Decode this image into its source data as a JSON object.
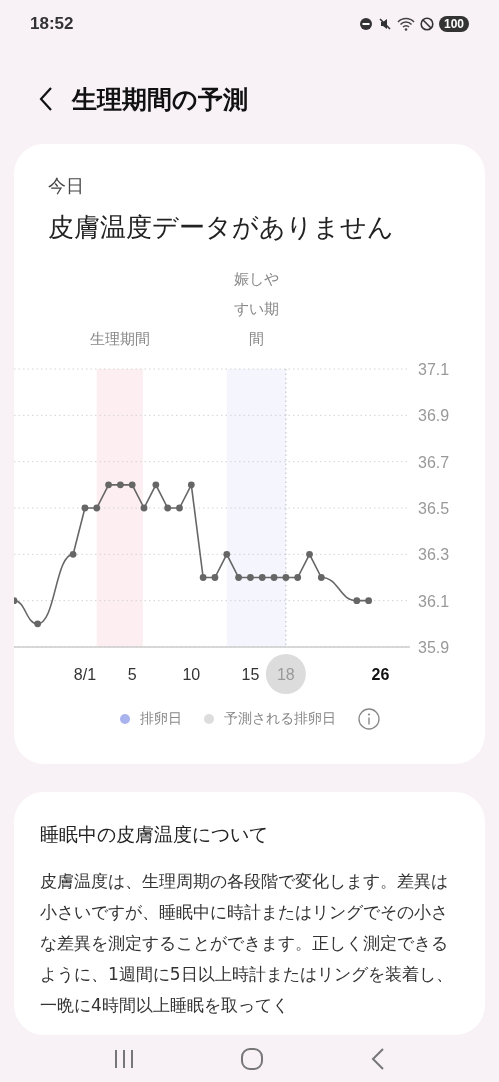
{
  "status_bar": {
    "time": "18:52",
    "battery": "100"
  },
  "header": {
    "title": "生理期間の予測"
  },
  "summary_card": {
    "label": "今日",
    "message": "皮膚温度データがありません",
    "chart_data": {
      "type": "line",
      "x": [
        -5,
        -3,
        0,
        1,
        2,
        3,
        4,
        5,
        6,
        7,
        8,
        9,
        10,
        11,
        12,
        13,
        14,
        15,
        16,
        17,
        18,
        19,
        20,
        21,
        24,
        25
      ],
      "grid": true,
      "series": [
        {
          "color": "#666666",
          "marker": "o",
          "values": [
            36.1,
            36.0,
            36.3,
            36.5,
            36.5,
            36.6,
            36.6,
            36.6,
            36.5,
            36.6,
            36.5,
            36.5,
            36.6,
            36.2,
            36.2,
            36.3,
            36.2,
            36.2,
            36.2,
            36.2,
            36.2,
            36.2,
            36.3,
            36.2,
            36.1,
            36.1
          ]
        }
      ],
      "xlim": [
        -5,
        28.5
      ],
      "ylim": [
        35.9,
        37.1
      ],
      "xticks": [
        {
          "value": 1,
          "label": "8/1"
        },
        {
          "value": 5,
          "label": "5"
        },
        {
          "value": 10,
          "label": "10"
        },
        {
          "value": 15,
          "label": "15"
        },
        {
          "value": 18,
          "label": "18"
        },
        {
          "value": 26,
          "label": "26"
        }
      ],
      "yticks": [
        {
          "value": 37.1,
          "label": "37.1"
        },
        {
          "value": 36.9,
          "label": "36.9"
        },
        {
          "value": 36.7,
          "label": "36.7"
        },
        {
          "value": 36.5,
          "label": "36.5"
        },
        {
          "value": 36.3,
          "label": "36.3"
        },
        {
          "value": 36.1,
          "label": "36.1"
        },
        {
          "value": 35.9,
          "label": "35.9"
        }
      ],
      "bands": [
        {
          "axis": "x",
          "from": 2,
          "to": 5.9,
          "label": "生理期間",
          "color": "#fdeef2"
        },
        {
          "axis": "x",
          "from": 13,
          "to": 18,
          "label": "娠しやすい期間",
          "color": "#f4f5fd"
        }
      ],
      "ref_lines": [
        {
          "axis": "x",
          "value": 18,
          "color": "#b8b8c8"
        }
      ]
    },
    "tick_states": [
      {
        "selected": false,
        "today": false
      },
      {
        "selected": false,
        "today": false
      },
      {
        "selected": false,
        "today": false
      },
      {
        "selected": false,
        "today": false
      },
      {
        "selected": true,
        "today": false
      },
      {
        "selected": false,
        "today": true
      }
    ],
    "legend": [
      {
        "label": "排卵日",
        "color": "#a9b3ee"
      },
      {
        "label": "予測される排卵日",
        "color": "#dddddd"
      }
    ]
  },
  "info_card": {
    "title": "睡眠中の皮膚温度について",
    "body": "皮膚温度は、生理周期の各段階で変化します。差異は小さいですが、睡眠中に時計またはリングでその小さな差異を測定することができます。正しく測定できるように、1週間に5日以上時計またはリングを装着し、一晩に4時間以上睡眠を取ってく"
  }
}
